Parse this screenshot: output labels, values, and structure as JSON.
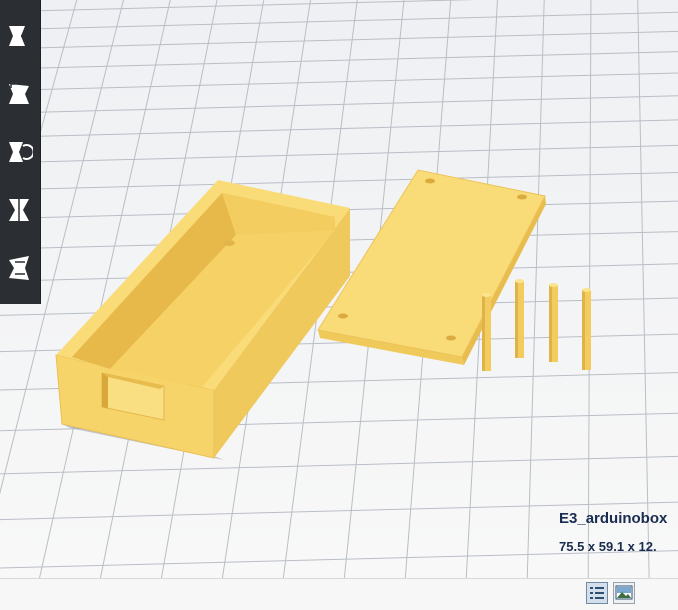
{
  "app": {
    "toolbar": {
      "tools": [
        {
          "name": "move-tool",
          "icon": "move-icon"
        },
        {
          "name": "scale-tool",
          "icon": "scale-icon"
        },
        {
          "name": "rotate-tool",
          "icon": "rotate-icon"
        },
        {
          "name": "mirror-tool",
          "icon": "mirror-icon"
        },
        {
          "name": "per-model-settings-tool",
          "icon": "per-model-settings-icon"
        }
      ]
    },
    "model": {
      "name": "E3_arduinobox",
      "dimensions": "75.5 x 59.1 x 12."
    },
    "view_buttons": [
      {
        "name": "list-view-icon",
        "active": true
      },
      {
        "name": "image-view-icon",
        "active": false
      }
    ],
    "colors": {
      "model_fill": "#f7d46a",
      "model_shadow": "#d9ae3a",
      "toolbar_bg": "#2b2f33",
      "grid_line": "#b9bec6",
      "text_dark_blue": "#1a2c4f"
    }
  }
}
